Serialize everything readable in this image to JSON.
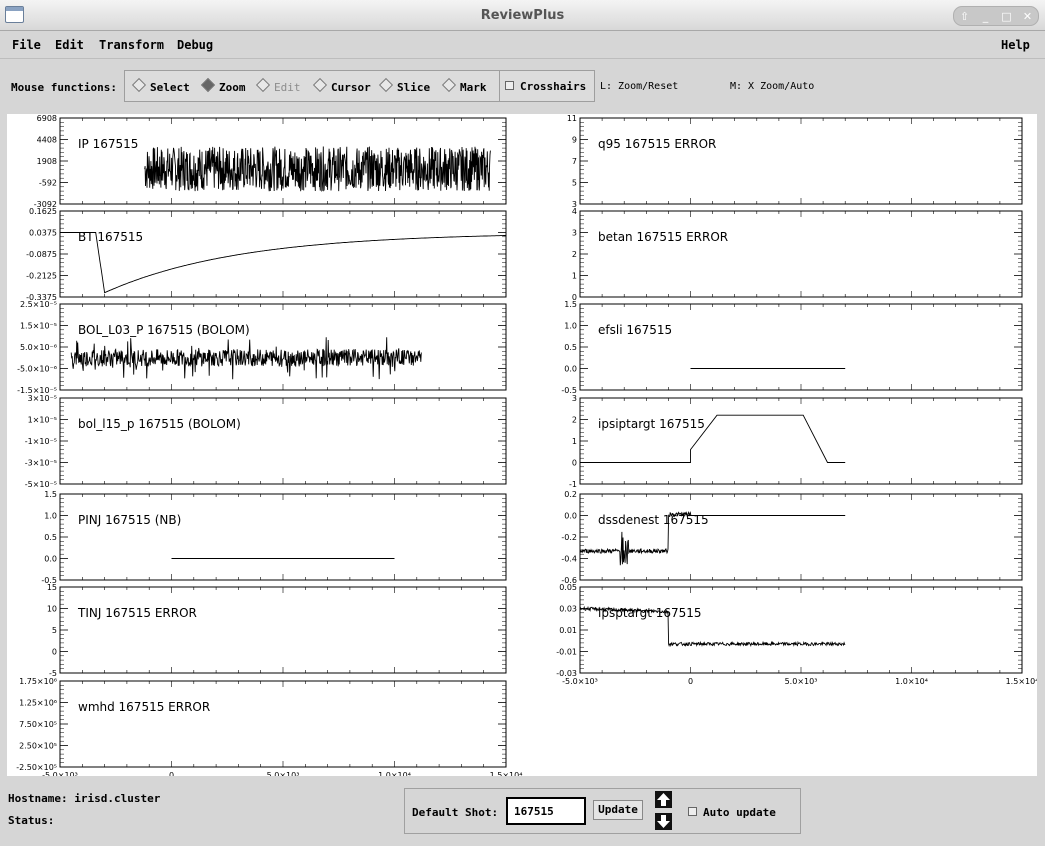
{
  "window": {
    "title": "ReviewPlus"
  },
  "menu": {
    "file": "File",
    "edit": "Edit",
    "transform": "Transform",
    "debug": "Debug",
    "help": "Help"
  },
  "toolbar": {
    "mouse_functions_label": "Mouse functions:",
    "modes": [
      {
        "label": "Select",
        "selected": false,
        "enabled": true
      },
      {
        "label": "Zoom",
        "selected": true,
        "enabled": true
      },
      {
        "label": "Edit",
        "selected": false,
        "enabled": false
      },
      {
        "label": "Cursor",
        "selected": false,
        "enabled": true
      },
      {
        "label": "Slice",
        "selected": false,
        "enabled": true
      },
      {
        "label": "Mark",
        "selected": false,
        "enabled": true
      }
    ],
    "crosshairs_label": "Crosshairs",
    "hint_left": "L: Zoom/Reset",
    "hint_middle": "M: X Zoom/Auto"
  },
  "status": {
    "hostname_label": "Hostname: irisd.cluster",
    "status_label": "Status:"
  },
  "shot": {
    "label": "Default Shot:",
    "value": "167515",
    "update_label": "Update",
    "auto_update_label": "Auto update"
  },
  "chart_data": [
    {
      "type": "line",
      "label": "IP  167515",
      "ytick_labels": [
        "6908",
        "4408",
        "1908",
        "-592",
        "-3092"
      ],
      "yticks": [
        6908,
        4408,
        1908,
        -592,
        -3092
      ],
      "ylim": [
        -3092,
        6908
      ],
      "xlim": [
        -5000,
        15000
      ]
    },
    {
      "type": "line",
      "label": "BT  167515",
      "ytick_labels": [
        "0.1625",
        "0.0375",
        "-0.0875",
        "-0.2125",
        "-0.3375"
      ],
      "yticks": [
        0.1625,
        0.0375,
        -0.0875,
        -0.2125,
        -0.3375
      ],
      "ylim": [
        -0.3375,
        0.1625
      ],
      "xlim": [
        -5000,
        15000
      ]
    },
    {
      "type": "line",
      "label": "BOL_L03_P  167515 (BOLOM)",
      "ytick_labels": [
        "2.5×10⁻⁵",
        "1.5×10⁻⁵",
        "5.0×10⁻⁶",
        "-5.0×10⁻⁶",
        "-1.5×10⁻⁵"
      ],
      "yticks": [
        2.5e-05,
        1.5e-05,
        5e-06,
        -5e-06,
        -1.5e-05
      ],
      "ylim": [
        -1.5e-05,
        2.5e-05
      ],
      "xlim": [
        -5000,
        15000
      ]
    },
    {
      "type": "line",
      "label": "bol_l15_p  167515 (BOLOM)",
      "ytick_labels": [
        "3×10⁻⁵",
        "1×10⁻⁵",
        "-1×10⁻⁵",
        "-3×10⁻⁵",
        "-5×10⁻⁵"
      ],
      "yticks": [
        3e-05,
        1e-05,
        -1e-05,
        -3e-05,
        -5e-05
      ],
      "ylim": [
        -5e-05,
        3e-05
      ],
      "xlim": [
        -5000,
        15000
      ]
    },
    {
      "type": "line",
      "label": "PINJ  167515 (NB)",
      "ytick_labels": [
        "1.5",
        "1.0",
        "0.5",
        "0.0",
        "-0.5"
      ],
      "yticks": [
        1.5,
        1.0,
        0.5,
        0.0,
        -0.5
      ],
      "ylim": [
        -0.5,
        1.5
      ],
      "xlim": [
        -5000,
        15000
      ],
      "x": [
        0,
        10000
      ],
      "y": [
        0,
        0
      ]
    },
    {
      "type": "line",
      "label": "TINJ  167515 ERROR",
      "ytick_labels": [
        "15",
        "10",
        "5",
        "0",
        "-5"
      ],
      "yticks": [
        15,
        10,
        5,
        0,
        -5
      ],
      "ylim": [
        -5,
        15
      ],
      "xlim": [
        -5000,
        15000
      ]
    },
    {
      "type": "line",
      "label": "wmhd  167515 ERROR",
      "ytick_labels": [
        "1.75×10⁶",
        "1.25×10⁶",
        "7.50×10⁵",
        "2.50×10⁵",
        "-2.50×10⁵"
      ],
      "yticks": [
        1750000,
        1250000,
        750000,
        250000,
        -250000
      ],
      "ylim": [
        -250000,
        1750000
      ],
      "xlim": [
        -5000,
        15000
      ],
      "xtick_labels": [
        "-5.0×10³",
        "0",
        "5.0×10³",
        "1.0×10⁴",
        "1.5×10⁴"
      ],
      "xticks": [
        -5000,
        0,
        5000,
        10000,
        15000
      ]
    },
    {
      "type": "line",
      "label": "q95  167515 ERROR",
      "ytick_labels": [
        "11",
        "9",
        "7",
        "5",
        "3"
      ],
      "yticks": [
        11,
        9,
        7,
        5,
        3
      ],
      "ylim": [
        3,
        11
      ],
      "xlim": [
        -5000,
        15000
      ]
    },
    {
      "type": "line",
      "label": "betan  167515 ERROR",
      "ytick_labels": [
        "4",
        "3",
        "2",
        "1",
        "0"
      ],
      "yticks": [
        4,
        3,
        2,
        1,
        0
      ],
      "ylim": [
        0,
        4
      ],
      "xlim": [
        -5000,
        15000
      ]
    },
    {
      "type": "line",
      "label": "efsli  167515",
      "ytick_labels": [
        "1.5",
        "1.0",
        "0.5",
        "0.0",
        "-0.5"
      ],
      "yticks": [
        1.5,
        1.0,
        0.5,
        0.0,
        -0.5
      ],
      "ylim": [
        -0.5,
        1.5
      ],
      "xlim": [
        -5000,
        15000
      ],
      "x": [
        0,
        7000
      ],
      "y": [
        0,
        0
      ]
    },
    {
      "type": "line",
      "label": "ipsiptargt  167515",
      "ytick_labels": [
        "3",
        "2",
        "1",
        "0",
        "-1"
      ],
      "yticks": [
        3,
        2,
        1,
        0,
        -1
      ],
      "ylim": [
        -1,
        3
      ],
      "xlim": [
        -5000,
        15000
      ],
      "x": [
        -5000,
        0,
        0,
        1200,
        5100,
        6200,
        7000
      ],
      "y": [
        0,
        0,
        0.6,
        2.2,
        2.2,
        0,
        0
      ]
    },
    {
      "type": "line",
      "label": "dssdenest  167515",
      "ytick_labels": [
        "0.2",
        "0.0",
        "-0.2",
        "-0.4",
        "-0.6"
      ],
      "yticks": [
        0.2,
        0.0,
        -0.2,
        -0.4,
        -0.6
      ],
      "ylim": [
        -0.6,
        0.2
      ],
      "xlim": [
        -5000,
        15000
      ]
    },
    {
      "type": "line",
      "label": "ipsptargt  167515",
      "ytick_labels": [
        "0.05",
        "0.03",
        "0.01",
        "-0.01",
        "-0.03"
      ],
      "yticks": [
        0.05,
        0.03,
        0.01,
        -0.01,
        -0.03
      ],
      "ylim": [
        -0.03,
        0.05
      ],
      "xlim": [
        -5000,
        15000
      ],
      "xtick_labels": [
        "-5.0×10³",
        "0",
        "5.0×10³",
        "1.0×10⁴",
        "1.5×10⁴"
      ],
      "xticks": [
        -5000,
        0,
        5000,
        10000,
        15000
      ]
    }
  ]
}
